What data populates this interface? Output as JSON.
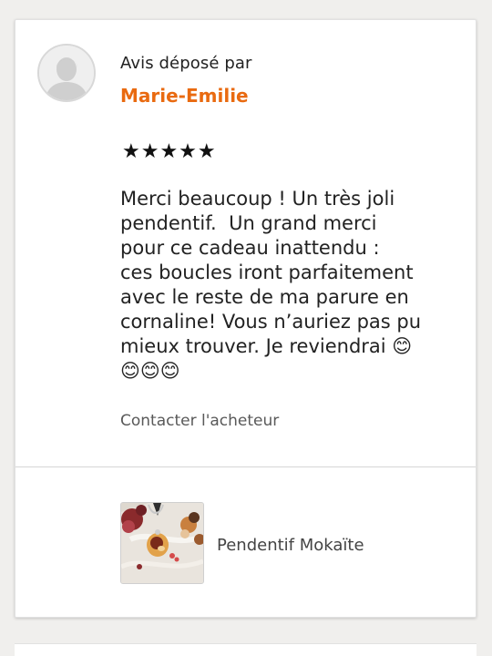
{
  "review": {
    "posted_by_label": "Avis déposé par",
    "author": "Marie-Emilie",
    "rating": 5,
    "rating_max": 5,
    "stars_text": "★★★★★",
    "text": "Merci beaucoup ! Un très joli\npendentif.  Un grand merci\npour ce cadeau inattendu :\nces boucles iront parfaitement\navec le reste de ma parure en\ncornaline! Vous n’auriez pas pu\nmieux trouver. Je reviendrai 😊\n😊😊😊",
    "contact_label": "Contacter l'acheteur"
  },
  "product": {
    "name": "Pendentif Mokaïte"
  },
  "icons": {
    "avatar": "default-user-avatar-icon",
    "rating": "star-icon"
  },
  "colors": {
    "author": "#e96a10",
    "text": "#222222",
    "link": "#595959"
  }
}
